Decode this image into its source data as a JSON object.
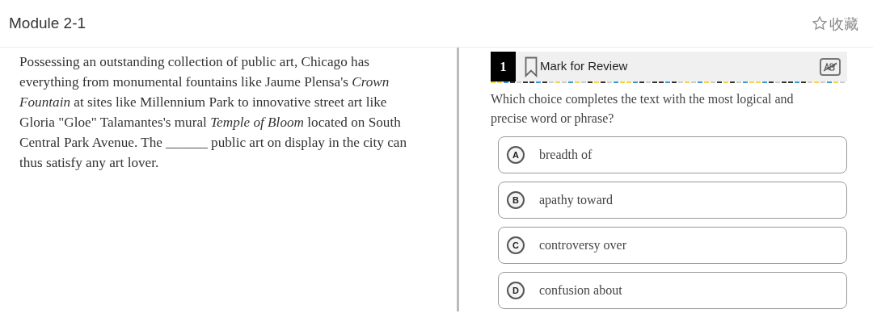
{
  "header": {
    "title": "Module 2-1",
    "favorite": {
      "label": "收藏",
      "selected": false
    }
  },
  "passage": "Possessing an outstanding collection of public art, Chicago has everything from monumental fountains like Jaume Plensa's *Crown Fountain* at sites like Millennium Park to innovative street art like Gloria \"Gloe\" Talamantes's mural *Temple of Bloom* located on South Central Park Avenue. The ______ public art on display in the city can thus satisfy any art lover.",
  "question": {
    "number": "1",
    "mark_for_review": {
      "label": "Mark for Review",
      "marked": false
    },
    "prompt": "Which choice completes the text with the most logical and precise word or phrase?",
    "options": [
      {
        "letter": "A",
        "text": "breadth of",
        "selected": false
      },
      {
        "letter": "B",
        "text": "apathy toward",
        "selected": false
      },
      {
        "letter": "C",
        "text": "controversy over",
        "selected": false
      },
      {
        "letter": "D",
        "text": "confusion about",
        "selected": false
      }
    ]
  }
}
